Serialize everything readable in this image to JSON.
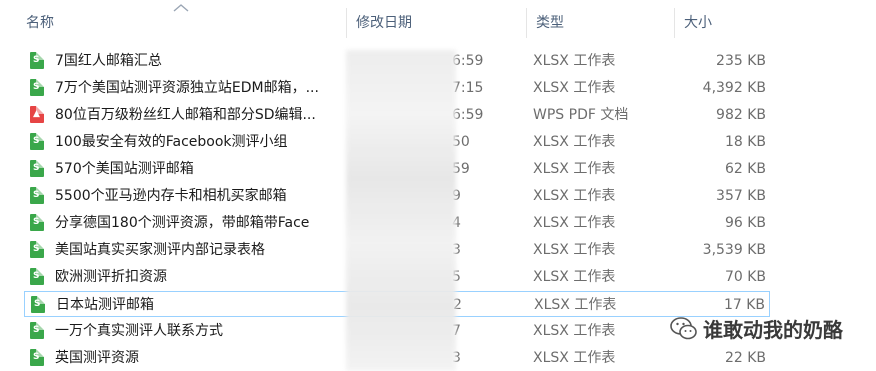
{
  "columns": {
    "name": "名称",
    "date": "修改日期",
    "type": "类型",
    "size": "大小"
  },
  "files": [
    {
      "name": "7国红人邮箱汇总",
      "date": "6:59",
      "type": "XLSX 工作表",
      "size": "235 KB",
      "icon": "xlsx-file-icon"
    },
    {
      "name": "7万个美国站测评资源独立站EDM邮箱，...",
      "date": "7:15",
      "type": "XLSX 工作表",
      "size": "4,392 KB",
      "icon": "xlsx-file-icon"
    },
    {
      "name": "80位百万级粉丝红人邮箱和部分SD编辑...",
      "date": "6:59",
      "type": "WPS PDF 文档",
      "size": "982 KB",
      "icon": "pdf-file-icon"
    },
    {
      "name": "100最安全有效的Facebook测评小组",
      "date": "50",
      "type": "XLSX 工作表",
      "size": "18 KB",
      "icon": "xlsx-file-icon"
    },
    {
      "name": "570个美国站测评邮箱",
      "date": "59",
      "type": "XLSX 工作表",
      "size": "62 KB",
      "icon": "xlsx-file-icon"
    },
    {
      "name": "5500个亚马逊内存卡和相机买家邮箱",
      "date": "9",
      "type": "XLSX 工作表",
      "size": "357 KB",
      "icon": "xlsx-file-icon"
    },
    {
      "name": "分享德国180个测评资源，带邮箱带Face",
      "date": "4",
      "type": "XLSX 工作表",
      "size": "96 KB",
      "icon": "xlsx-file-icon"
    },
    {
      "name": "美国站真实买家测评内部记录表格",
      "date": "3",
      "type": "XLSX 工作表",
      "size": "3,539 KB",
      "icon": "xlsx-file-icon"
    },
    {
      "name": "欧洲测评折扣资源",
      "date": "5",
      "type": "XLSX 工作表",
      "size": "70 KB",
      "icon": "xlsx-file-icon"
    },
    {
      "name": "日本站测评邮箱",
      "date": "2",
      "type": "XLSX 工作表",
      "size": "17 KB",
      "icon": "xlsx-file-icon",
      "selected": true
    },
    {
      "name": "一万个真实测评人联系方式",
      "date": "7",
      "type": "XLSX 工作表",
      "size": "",
      "icon": "xlsx-file-icon"
    },
    {
      "name": "英国测评资源",
      "date": "3",
      "type": "XLSX 工作表",
      "size": "22 KB",
      "icon": "xlsx-file-icon"
    }
  ],
  "watermark": {
    "text": "谁敢动我的奶酪",
    "icon": "wechat-icon"
  },
  "colors": {
    "header_text": "#4c607a",
    "xlsx_icon": "#3aa74a",
    "pdf_icon": "#e64444",
    "selection_border": "#99d1ff"
  }
}
